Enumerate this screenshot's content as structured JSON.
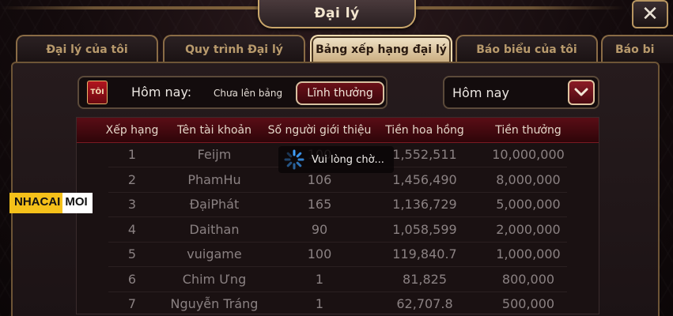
{
  "window": {
    "title": "Đại lý",
    "close_glyph": "✕"
  },
  "tabs": [
    {
      "label": "Đại lý của tôi",
      "active": false
    },
    {
      "label": "Quy trình Đại lý",
      "active": false
    },
    {
      "label": "Bảng xếp hạng đại lý",
      "active": true
    },
    {
      "label": "Báo biểu của tôi",
      "active": false
    },
    {
      "label": "Báo bi",
      "active": false
    }
  ],
  "filter": {
    "badge": "TÔI",
    "label": "Hôm nay:",
    "option_text": "Chưa lên bảng",
    "button_label": "Lĩnh thưởng"
  },
  "date_select": {
    "value": "Hôm nay",
    "icon": "chevron-down-icon"
  },
  "table": {
    "headers": [
      "Xếp hạng",
      "Tên tài khoản",
      "Số người giới thiệu",
      "Tiền hoa hồng",
      "Tiền thưởng"
    ],
    "rows": [
      [
        "1",
        "Feijm",
        "100",
        "1,552,511",
        "10,000,000"
      ],
      [
        "2",
        "PhamHu",
        "106",
        "1,456,490",
        "8,000,000"
      ],
      [
        "3",
        "ĐạiPhát",
        "165",
        "1,136,729",
        "5,000,000"
      ],
      [
        "4",
        "Daithan",
        "90",
        "1,058,599",
        "2,000,000"
      ],
      [
        "5",
        "vuigame",
        "100",
        "119,840.7",
        "1,000,000"
      ],
      [
        "6",
        "Chim Ưng",
        "1",
        "81,825",
        "800,000"
      ],
      [
        "7",
        "Nguyễn Tráng",
        "1",
        "62,707.8",
        "500,000"
      ]
    ]
  },
  "loading": {
    "text": "Vui lòng chờ..."
  },
  "watermark": {
    "part_a": "NHACAI",
    "part_b": "MOI"
  },
  "colors": {
    "accent_gold": "#c9a66b",
    "accent_red": "#6a0f18"
  }
}
